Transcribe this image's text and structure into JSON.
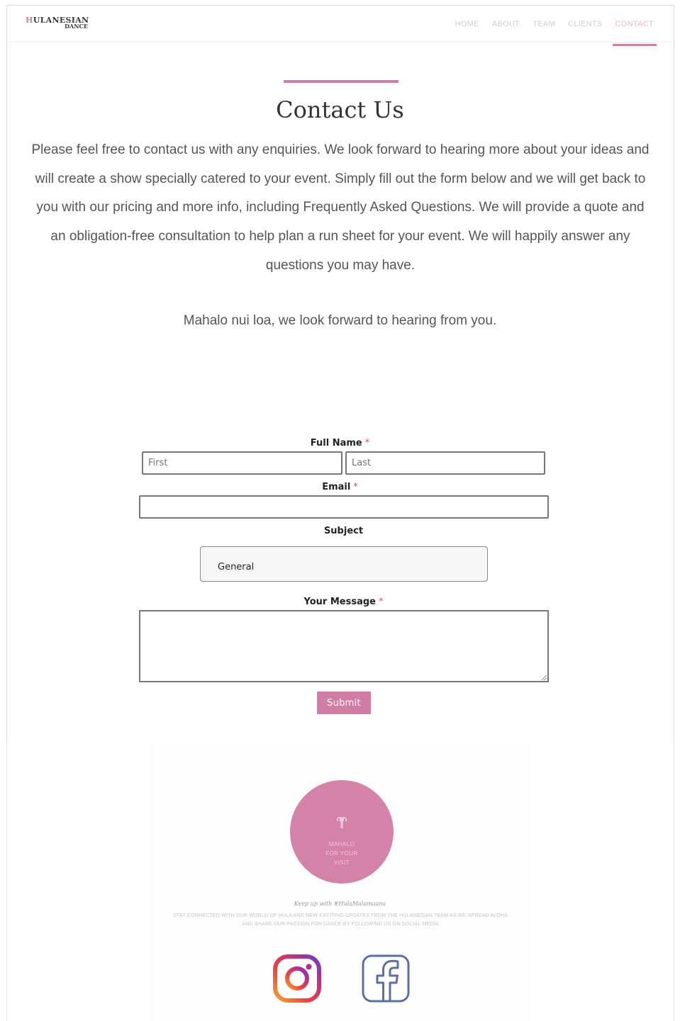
{
  "brand": {
    "logo_line1_first": "H",
    "logo_line1_rest": "ULANESIAN",
    "logo_line2": "DANCE",
    "accent": "#d27ea4"
  },
  "nav": {
    "items": [
      "HOME",
      "ABOUT",
      "TEAM",
      "CLIENTS",
      "CONTACT"
    ],
    "active": "CONTACT"
  },
  "main": {
    "title": "Contact Us",
    "intro": "Please feel free to contact us with any enquiries. We look forward to hearing more about your ideas and will create a show specially catered to your event. Simply fill out the form below and we will get back to you with our pricing and more info, including Frequently Asked Questions. We will provide a quote and an obligation-free consultation to help plan a run sheet for your event. We will happily answer any questions you may have.",
    "mahalo": "Mahalo nui loa, we look forward to hearing from you."
  },
  "form": {
    "full_name_label": "Full Name",
    "required_mark": "*",
    "first_placeholder": "First",
    "last_placeholder": "Last",
    "email_label": "Email",
    "email_value": "",
    "subject_label": "Subject",
    "subject_selected": "General",
    "message_label": "Your Message",
    "message_value": "",
    "submit_label": "Submit"
  },
  "footer": {
    "badge_icon": "hand-icon",
    "badge_lines": [
      "MAHALO",
      "FOR YOUR",
      "VISIT"
    ],
    "keep_up": "Keep up with #HulaMalamaana",
    "stay_connected": "STAY CONNECTED WITH OUR WORLD OF HULA AND NEW EXCITING UPDATES FROM THE HULANESIAN TEAM AS WE SPREAD ALOHA AND SHARE OUR PASSION FOR DANCE BY FOLLOWING US ON SOCIAL MEDIA",
    "social_icons": [
      "instagram-icon",
      "facebook-icon"
    ]
  }
}
